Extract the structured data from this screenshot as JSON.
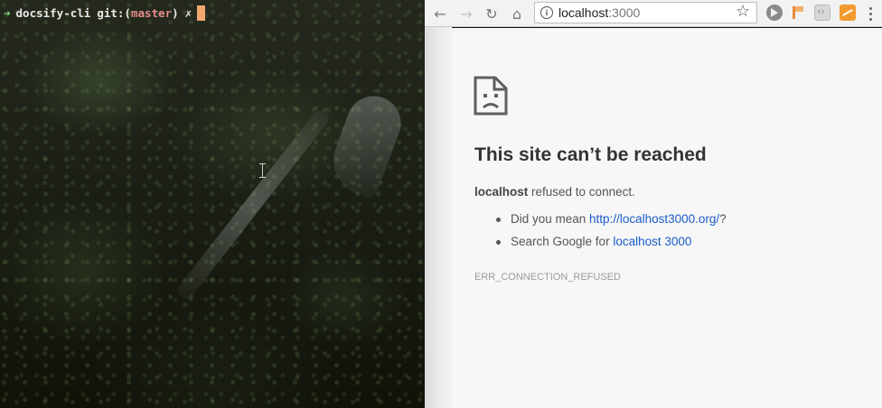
{
  "terminal": {
    "prompt_arrow": "➜",
    "directory": "docsify-cli",
    "git_label": "git:(",
    "branch": "master",
    "git_close": ")",
    "dirty_marker": "✗"
  },
  "browser": {
    "toolbar": {
      "back_glyph": "←",
      "forward_glyph": "→",
      "reload_glyph": "↻",
      "home_glyph": "⌂",
      "url_host": "localhost",
      "url_port": ":3000",
      "info_glyph": "i",
      "star_glyph": "☆"
    },
    "error_page": {
      "heading": "This site can’t be reached",
      "host": "localhost",
      "refused_text": " refused to connect.",
      "suggestion_1_prefix": "Did you mean ",
      "suggestion_1_link": "http://localhost3000.org/",
      "suggestion_1_suffix": "?",
      "suggestion_2_prefix": "Search Google for ",
      "suggestion_2_link": "localhost 3000",
      "error_code": "ERR_CONNECTION_REFUSED"
    }
  },
  "icons": {
    "terminal": [
      "prompt-arrow-icon",
      "text-cursor-icon",
      "ibeam-cursor-icon"
    ],
    "browser": [
      "back-arrow-icon",
      "forward-arrow-icon",
      "reload-icon",
      "home-icon",
      "info-icon",
      "star-icon",
      "extension-icons",
      "menu-icon",
      "sad-document-icon"
    ]
  },
  "colors": {
    "link": "#1a5cc8",
    "terminal_cursor": "#f0a870",
    "branch": "#e38a8a",
    "prompt_arrow": "#7fe27f"
  }
}
